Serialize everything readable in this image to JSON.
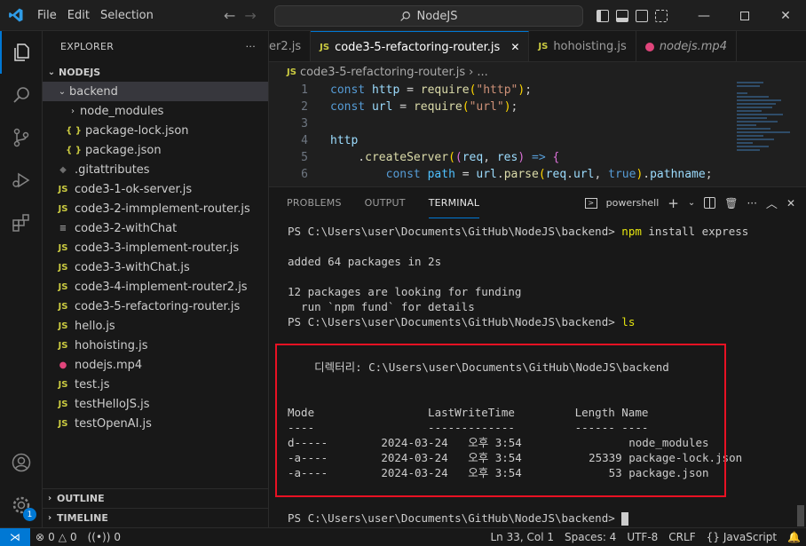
{
  "titlebar": {
    "menu": [
      "File",
      "Edit",
      "Selection"
    ],
    "search": "NodeJS"
  },
  "sidebar": {
    "title": "EXPLORER",
    "root": "NODEJS",
    "items": [
      {
        "label": "backend",
        "kind": "folder-open",
        "indent": 1
      },
      {
        "label": "node_modules",
        "kind": "folder",
        "indent": 2
      },
      {
        "label": "package-lock.json",
        "kind": "json",
        "indent": 2
      },
      {
        "label": "package.json",
        "kind": "json",
        "indent": 2
      },
      {
        "label": ".gitattributes",
        "kind": "git",
        "indent": 1
      },
      {
        "label": "code3-1-ok-server.js",
        "kind": "js",
        "indent": 1
      },
      {
        "label": "code3-2-immplement-router.js",
        "kind": "js",
        "indent": 1
      },
      {
        "label": "code3-2-withChat",
        "kind": "txt",
        "indent": 1
      },
      {
        "label": "code3-3-implement-router.js",
        "kind": "js",
        "indent": 1
      },
      {
        "label": "code3-3-withChat.js",
        "kind": "js",
        "indent": 1
      },
      {
        "label": "code3-4-implement-router2.js",
        "kind": "js",
        "indent": 1
      },
      {
        "label": "code3-5-refactoring-router.js",
        "kind": "js",
        "indent": 1
      },
      {
        "label": "hello.js",
        "kind": "js",
        "indent": 1
      },
      {
        "label": "hohoisting.js",
        "kind": "js",
        "indent": 1
      },
      {
        "label": "nodejs.mp4",
        "kind": "mp4",
        "indent": 1
      },
      {
        "label": "test.js",
        "kind": "js",
        "indent": 1
      },
      {
        "label": "testHelloJS.js",
        "kind": "js",
        "indent": 1
      },
      {
        "label": "testOpenAI.js",
        "kind": "js",
        "indent": 1
      }
    ],
    "outline": "OUTLINE",
    "timeline": "TIMELINE"
  },
  "tabs": [
    {
      "label": "er2.js",
      "icon": ""
    },
    {
      "label": "code3-5-refactoring-router.js",
      "icon": "JS"
    },
    {
      "label": "hohoisting.js",
      "icon": "JS"
    },
    {
      "label": "nodejs.mp4",
      "icon": "mp4"
    }
  ],
  "breadcrumb": {
    "file": "code3-5-refactoring-router.js",
    "more": "..."
  },
  "code": {
    "line_numbers": [
      "1",
      "2",
      "3",
      "4",
      "5",
      "6"
    ],
    "l1": {
      "kw": "const",
      "var": "http",
      "eq": "=",
      "fn": "require",
      "str": "\"http\""
    },
    "l2": {
      "kw": "const",
      "var": "url",
      "eq": "=",
      "fn": "require",
      "str": "\"url\""
    },
    "l4": {
      "var": "http"
    },
    "l5": {
      "fn": "createServer",
      "p1": "req",
      "p2": "res",
      "arrow": "=>"
    },
    "l6": {
      "kw": "const",
      "var": "path",
      "eq": "=",
      "obj": "url",
      "fn": "parse",
      "arg1": "req",
      "arg1b": "url",
      "arg2": "true",
      "prop": "pathname"
    }
  },
  "panel": {
    "tabs": [
      "PROBLEMS",
      "OUTPUT",
      "TERMINAL"
    ],
    "shell": "powershell"
  },
  "terminal": {
    "prompt1": "PS C:\\Users\\user\\Documents\\GitHub\\NodeJS\\backend> ",
    "cmd1a": "npm",
    "cmd1b": " install express",
    "out1": "added 64 packages in 2s",
    "out2": "12 packages are looking for funding",
    "out3": "  run `npm fund` for details",
    "prompt2": "PS C:\\Users\\user\\Documents\\GitHub\\NodeJS\\backend> ",
    "cmd2": "ls",
    "dir_line": "    디렉터리: C:\\Users\\user\\Documents\\GitHub\\NodeJS\\backend",
    "header": "Mode                 LastWriteTime         Length Name",
    "sep": "----                 -------------         ------ ----",
    "row1": "d-----        2024-03-24   오후 3:54                node_modules",
    "row2": "-a----        2024-03-24   오후 3:54          25339 package-lock.json",
    "row3": "-a----        2024-03-24   오후 3:54             53 package.json",
    "prompt3": "PS C:\\Users\\user\\Documents\\GitHub\\NodeJS\\backend> "
  },
  "status": {
    "errors": "0",
    "warnings": "0",
    "ports": "0",
    "position": "Ln 33, Col 1",
    "spaces": "Spaces: 4",
    "encoding": "UTF-8",
    "eol": "CRLF",
    "language": "JavaScript",
    "accounts_badge": "1"
  },
  "colors": {
    "accent": "#0078d4",
    "highlight": "#e81123"
  }
}
